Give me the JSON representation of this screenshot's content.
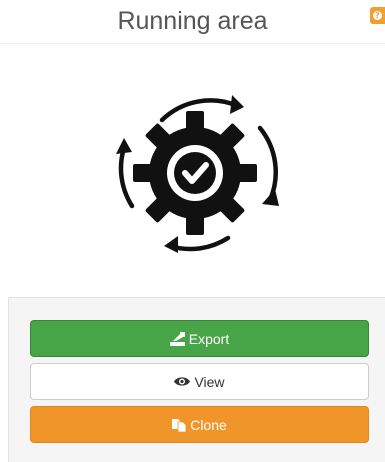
{
  "header": {
    "title": "Running area",
    "help_icon": "question-mark-icon"
  },
  "illustration": {
    "icon": "gear-checkmark-refresh-icon"
  },
  "actions": {
    "export_label": "Export",
    "export_icon": "export-icon",
    "view_label": "View",
    "view_icon": "eye-icon",
    "clone_label": "Clone",
    "clone_icon": "copy-icon"
  },
  "colors": {
    "export": "#47a447",
    "clone": "#f0952a",
    "help_badge": "#f0a030"
  }
}
